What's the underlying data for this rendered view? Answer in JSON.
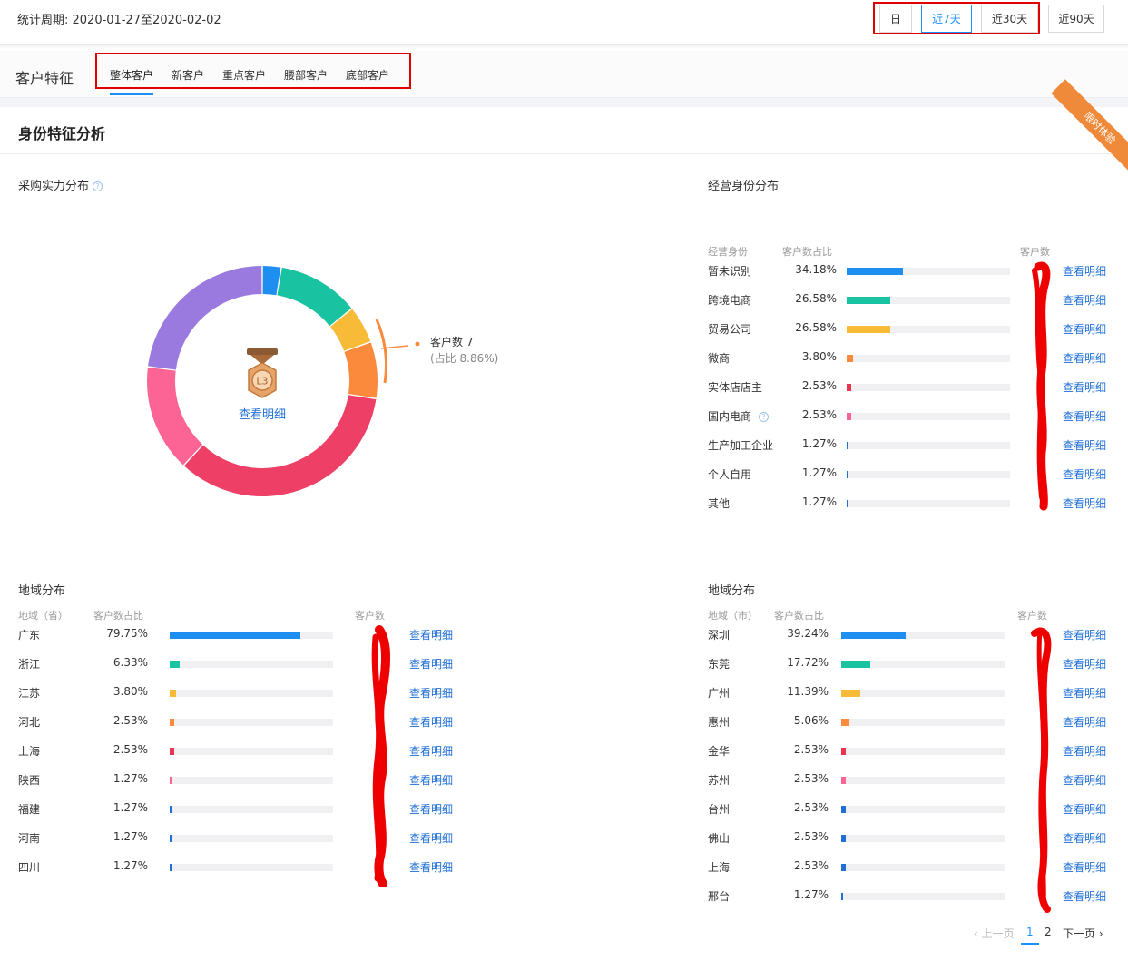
{
  "header": {
    "period": "统计周期: 2020-01-27至2020-02-02",
    "ranges": [
      {
        "label": "日",
        "active": false
      },
      {
        "label": "近7天",
        "active": true
      },
      {
        "label": "近30天",
        "active": false
      },
      {
        "label": "近90天",
        "active": false
      }
    ]
  },
  "tabs_section": {
    "title": "客户特征",
    "tabs": [
      "整体客户",
      "新客户",
      "重点客户",
      "腰部客户",
      "底部客户"
    ],
    "active_tab": 0
  },
  "card": {
    "title": "身份特征分析",
    "ribbon": "限时体验"
  },
  "purchase": {
    "title": "采购实力分布",
    "center_badge": "L3",
    "center_link": "查看明细",
    "tooltip_count": "客户数 7",
    "tooltip_share": "(占比 8.86%)",
    "colors": [
      "#1f8ef1",
      "#19c2a0",
      "#f7bb37",
      "#fb8a3c",
      "#ee3f66",
      "#fb6494",
      "#9b7ae0"
    ]
  },
  "chart_data": {
    "type": "pie",
    "title": "采购实力分布",
    "values": [
      3,
      13,
      6,
      9,
      39,
      17,
      26
    ],
    "colors": [
      "#1f8ef1",
      "#19c2a0",
      "#f7bb37",
      "#fb8a3c",
      "#ee3f66",
      "#fb6494",
      "#9b7ae0"
    ],
    "highlighted_index": 3
  },
  "identity": {
    "title": "经营身份分布",
    "headers": [
      "经营身份",
      "客户数占比",
      "客户数"
    ],
    "rows": [
      {
        "name": "暂未识别",
        "pct": "34.18%",
        "value": 34.18,
        "color": "#1f8ef1"
      },
      {
        "name": "跨境电商",
        "pct": "26.58%",
        "value": 26.58,
        "color": "#19c2a0"
      },
      {
        "name": "贸易公司",
        "pct": "26.58%",
        "value": 26.58,
        "color": "#f7bb37"
      },
      {
        "name": "微商",
        "pct": "3.80%",
        "value": 3.8,
        "color": "#fb8a3c"
      },
      {
        "name": "实体店店主",
        "pct": "2.53%",
        "value": 2.53,
        "color": "#e8344e"
      },
      {
        "name": "国内电商",
        "pct": "2.53%",
        "value": 2.53,
        "color": "#fb6494",
        "help": true
      },
      {
        "name": "生产加工企业",
        "pct": "1.27%",
        "value": 1.27,
        "color": "#1f6fd6"
      },
      {
        "name": "个人自用",
        "pct": "1.27%",
        "value": 1.27,
        "color": "#1f6fd6"
      },
      {
        "name": "其他",
        "pct": "1.27%",
        "value": 1.27,
        "color": "#1f6fd6"
      }
    ]
  },
  "province": {
    "title": "地域分布",
    "headers": [
      "地域（省）",
      "客户数占比",
      "客户数"
    ],
    "rows": [
      {
        "name": "广东",
        "pct": "79.75%",
        "value": 79.75,
        "color": "#1f8ef1"
      },
      {
        "name": "浙江",
        "pct": "6.33%",
        "value": 6.33,
        "color": "#19c2a0"
      },
      {
        "name": "江苏",
        "pct": "3.80%",
        "value": 3.8,
        "color": "#f7bb37"
      },
      {
        "name": "河北",
        "pct": "2.53%",
        "value": 2.53,
        "color": "#fb8a3c"
      },
      {
        "name": "上海",
        "pct": "2.53%",
        "value": 2.53,
        "color": "#e8344e"
      },
      {
        "name": "陕西",
        "pct": "1.27%",
        "value": 1.27,
        "color": "#fb6494"
      },
      {
        "name": "福建",
        "pct": "1.27%",
        "value": 1.27,
        "color": "#1f6fd6"
      },
      {
        "name": "河南",
        "pct": "1.27%",
        "value": 1.27,
        "color": "#1f6fd6"
      },
      {
        "name": "四川",
        "pct": "1.27%",
        "value": 1.27,
        "color": "#1f6fd6"
      }
    ]
  },
  "city": {
    "title": "地域分布",
    "headers": [
      "地域（市）",
      "客户数占比",
      "客户数"
    ],
    "rows": [
      {
        "name": "深圳",
        "pct": "39.24%",
        "value": 39.24,
        "color": "#1f8ef1"
      },
      {
        "name": "东莞",
        "pct": "17.72%",
        "value": 17.72,
        "color": "#19c2a0"
      },
      {
        "name": "广州",
        "pct": "11.39%",
        "value": 11.39,
        "color": "#f7bb37"
      },
      {
        "name": "惠州",
        "pct": "5.06%",
        "value": 5.06,
        "color": "#fb8a3c"
      },
      {
        "name": "金华",
        "pct": "2.53%",
        "value": 2.53,
        "color": "#e8344e"
      },
      {
        "name": "苏州",
        "pct": "2.53%",
        "value": 2.53,
        "color": "#fb6494"
      },
      {
        "name": "台州",
        "pct": "2.53%",
        "value": 2.53,
        "color": "#1f6fd6"
      },
      {
        "name": "佛山",
        "pct": "2.53%",
        "value": 2.53,
        "color": "#1f6fd6"
      },
      {
        "name": "上海",
        "pct": "2.53%",
        "value": 2.53,
        "color": "#1f6fd6"
      },
      {
        "name": "邢台",
        "pct": "1.27%",
        "value": 1.27,
        "color": "#1f6fd6"
      }
    ]
  },
  "detail_link": "查看明细",
  "pagination": {
    "prev": "上一页",
    "pages": [
      "1",
      "2"
    ],
    "current": "1",
    "next": "下一页"
  }
}
